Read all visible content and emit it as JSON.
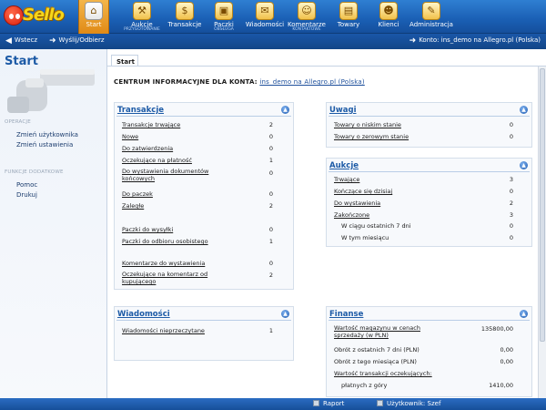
{
  "app": {
    "logo_text": "Sello"
  },
  "nav": [
    {
      "label": "Start",
      "sub": "",
      "icon": "home-icon",
      "glyph": "⌂",
      "active": true
    },
    {
      "label": "Aukcje",
      "sub": "PRZYGOTOWANIE",
      "icon": "gavel-icon",
      "glyph": "⚒",
      "active": false
    },
    {
      "label": "Transakcje",
      "sub": "",
      "icon": "coins-icon",
      "glyph": "$",
      "active": false
    },
    {
      "label": "Paczki",
      "sub": "OBSŁUGA",
      "icon": "package-icon",
      "glyph": "▣",
      "active": false
    },
    {
      "label": "Wiadomości",
      "sub": "",
      "icon": "envelope-icon",
      "glyph": "✉",
      "active": false
    },
    {
      "label": "Komentarze",
      "sub": "KONTAKTOWE",
      "icon": "comment-icon",
      "glyph": "☺",
      "active": false
    },
    {
      "label": "Towary",
      "sub": "",
      "icon": "box-icon",
      "glyph": "▤",
      "active": false
    },
    {
      "label": "Klienci",
      "sub": "",
      "icon": "client-icon",
      "glyph": "☻",
      "active": false
    },
    {
      "label": "Administracja",
      "sub": "",
      "icon": "admin-icon",
      "glyph": "✎",
      "active": false
    }
  ],
  "toolbar2": {
    "back_label": "Wstecz",
    "forward_label": "Wyślij/Odbierz",
    "account_label": "Konto: ins_demo na Allegro.pl (Polska)"
  },
  "sidebar": {
    "title": "Start",
    "section1": "OPERACJE",
    "links1": [
      "Zmień użytkownika",
      "Zmień ustawienia"
    ],
    "section2": "FUNKCJE DODATKOWE",
    "links2": [
      "Pomoc",
      "Drukuj"
    ]
  },
  "tab_label": "Start",
  "content": {
    "title": "CENTRUM INFORMACYJNE  DLA KONTA:",
    "account_link": "ins_demo na Allegro.pl (Polska)"
  },
  "transakcje": {
    "title": "Transakcje",
    "rows": [
      {
        "label": "Transakcje trwające",
        "value": "2"
      },
      {
        "label": "Nowe",
        "value": "0"
      },
      {
        "label": "Do zatwierdzenia",
        "value": "0"
      },
      {
        "label": "Oczekujące na płatność",
        "value": "1"
      },
      {
        "label": "Do wystawienia dokumentów końcowych",
        "value": "0"
      },
      {
        "label": "Do paczek",
        "value": "0"
      },
      {
        "label": "Zaległe",
        "value": "2"
      },
      {
        "label": "Paczki do wysyłki",
        "value": "0"
      },
      {
        "label": "Paczki do odbioru osobistego",
        "value": "1"
      },
      {
        "label": "Komentarze do wystawienia",
        "value": "0"
      },
      {
        "label": "Oczekujące na komentarz od kupującego",
        "value": "2"
      }
    ]
  },
  "uwagi": {
    "title": "Uwagi",
    "rows": [
      {
        "label": "Towary o niskim stanie",
        "value": "0"
      },
      {
        "label": "Towary o zerowym stanie",
        "value": "0"
      }
    ]
  },
  "aukcje": {
    "title": "Aukcje",
    "rows": [
      {
        "label": "Trwające",
        "value": "3"
      },
      {
        "label": "Kończące się dzisiaj",
        "value": "0"
      },
      {
        "label": "Do wystawienia",
        "value": "2"
      },
      {
        "label": "Zakończone",
        "value": "3"
      },
      {
        "label": "W ciągu ostatnich 7 dni",
        "value": "0"
      },
      {
        "label": "W tym miesiącu",
        "value": "0"
      }
    ]
  },
  "wiadomosci": {
    "title": "Wiadomości",
    "rows": [
      {
        "label": "Wiadomości nieprzeczytane",
        "value": "1"
      }
    ]
  },
  "finanse": {
    "title": "Finanse",
    "rows": [
      {
        "label": "Wartość magazynu w cenach sprzedaży (w PLN)",
        "value": "135800,00"
      },
      {
        "label": "Obrót z ostatnich 7 dni (PLN)",
        "value": "0,00"
      },
      {
        "label": "Obrót z tego miesiąca (PLN)",
        "value": "0,00"
      },
      {
        "label": "Wartość transakcji oczekujących:",
        "value": ""
      },
      {
        "label": "płatnych z góry",
        "value": "1410,00"
      }
    ]
  },
  "statusbar": {
    "report_label": "Raport",
    "user_label": "Użytkownik: Szef"
  }
}
